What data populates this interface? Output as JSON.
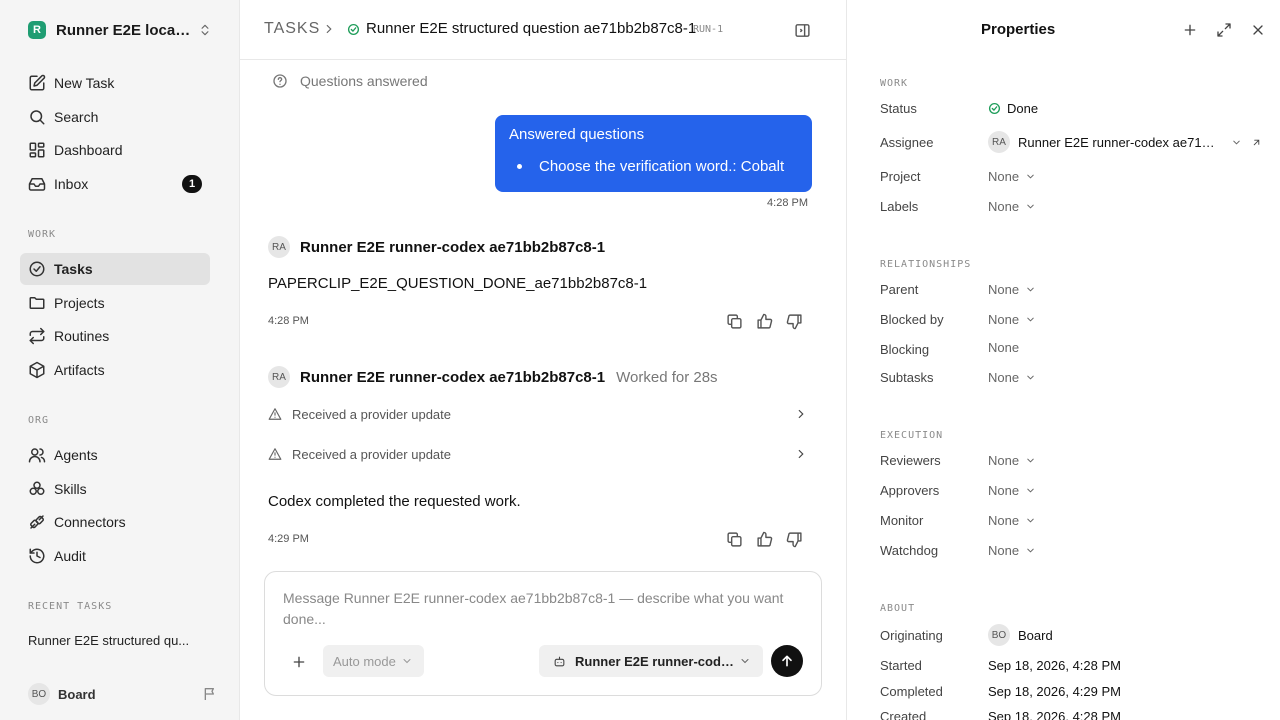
{
  "sidebar": {
    "workspace_logo": "R",
    "workspace_name": "Runner E2E local...",
    "nav": [
      {
        "label": "New Task",
        "icon": "new-task-icon"
      },
      {
        "label": "Search",
        "icon": "search-icon"
      },
      {
        "label": "Dashboard",
        "icon": "dashboard-icon"
      },
      {
        "label": "Inbox",
        "icon": "inbox-icon",
        "badge": "1"
      }
    ],
    "work_label": "WORK",
    "work_items": [
      {
        "label": "Tasks",
        "icon": "tasks-icon",
        "active": true
      },
      {
        "label": "Projects",
        "icon": "folder-icon"
      },
      {
        "label": "Routines",
        "icon": "routines-icon"
      },
      {
        "label": "Artifacts",
        "icon": "artifacts-icon"
      }
    ],
    "org_label": "ORG",
    "org_items": [
      {
        "label": "Agents",
        "icon": "agents-icon"
      },
      {
        "label": "Skills",
        "icon": "skills-icon"
      },
      {
        "label": "Connectors",
        "icon": "connectors-icon"
      },
      {
        "label": "Audit",
        "icon": "audit-icon"
      }
    ],
    "recent_label": "RECENT TASKS",
    "recent_task": "Runner E2E structured qu...",
    "user": {
      "initials": "BO",
      "name": "Board"
    }
  },
  "header": {
    "breadcrumb_root": "TASKS",
    "task_title": "Runner E2E structured question ae71bb2b87c8-1",
    "run_id": "RUN-1"
  },
  "thread": {
    "questions_answered": "Questions answered",
    "bubble": {
      "title": "Answered questions",
      "item": "Choose the verification word.: Cobalt",
      "time": "4:28 PM"
    },
    "message1": {
      "avatar": "RA",
      "author": "Runner E2E runner-codex ae71bb2b87c8-1",
      "text": "PAPERCLIP_E2E_QUESTION_DONE_ae71bb2b87c8-1",
      "time": "4:28 PM"
    },
    "message2": {
      "avatar": "RA",
      "author": "Runner E2E runner-codex ae71bb2b87c8-1",
      "meta": "Worked for 28s",
      "updates": [
        "Received a provider update",
        "Received a provider update"
      ],
      "text": "Codex completed the requested work.",
      "time": "4:29 PM"
    }
  },
  "composer": {
    "placeholder": "Message Runner E2E runner-codex ae71bb2b87c8-1 — describe what you want done...",
    "mode": "Auto mode",
    "agent": "Runner E2E runner-codex..."
  },
  "properties": {
    "title": "Properties",
    "work_label": "WORK",
    "status_label": "Status",
    "status_value": "Done",
    "assignee_label": "Assignee",
    "assignee_initials": "RA",
    "assignee_value": "Runner E2E runner-codex ae71bb...",
    "project_label": "Project",
    "labels_label": "Labels",
    "relationships_label": "RELATIONSHIPS",
    "parent_label": "Parent",
    "blocked_by_label": "Blocked by",
    "blocking_label": "Blocking",
    "subtasks_label": "Subtasks",
    "execution_label": "EXECUTION",
    "reviewers_label": "Reviewers",
    "approvers_label": "Approvers",
    "monitor_label": "Monitor",
    "watchdog_label": "Watchdog",
    "about_label": "ABOUT",
    "originating_label": "Originating",
    "originating_initials": "BO",
    "originating_value": "Board",
    "started_label": "Started",
    "started_value": "Sep 18, 2026, 4:28 PM",
    "completed_label": "Completed",
    "completed_value": "Sep 18, 2026, 4:29 PM",
    "created_label": "Created",
    "created_value": "Sep 18, 2026, 4:28 PM",
    "none": "None"
  },
  "colors": {
    "accent": "#2563eb",
    "status_done": "#1f9d5a",
    "workspace": "#1f9d72"
  }
}
